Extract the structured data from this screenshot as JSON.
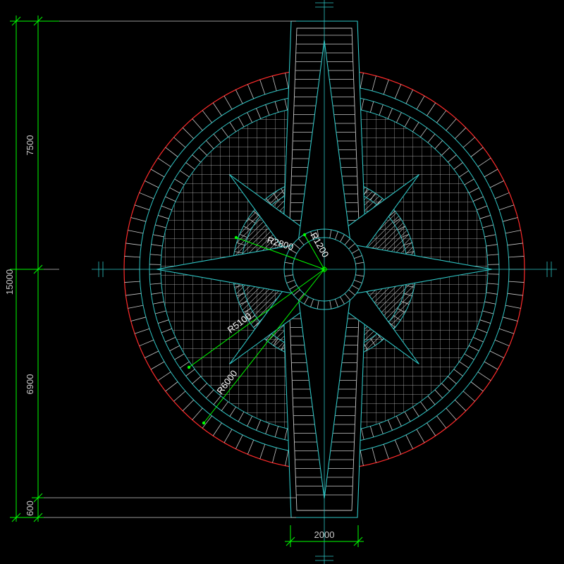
{
  "drawing": {
    "colors": {
      "background": "#000000",
      "dimension": "#00ff00",
      "outline": "#2ec4c4",
      "tile": "#c8c8c8",
      "outer_circle": "#ff2b2b",
      "center_mark": "#00ff00",
      "radius_text": "#ffffff"
    },
    "dimensions": {
      "total_height": "15000",
      "upper_segment": "7500",
      "lower_segment": "6900",
      "bottom_segment": "600",
      "path_width": "2000"
    },
    "radius_labels": {
      "r_small": "R1200",
      "r_inner": "R2800",
      "r_middle": "R5100",
      "r_outer": "R6000"
    }
  }
}
